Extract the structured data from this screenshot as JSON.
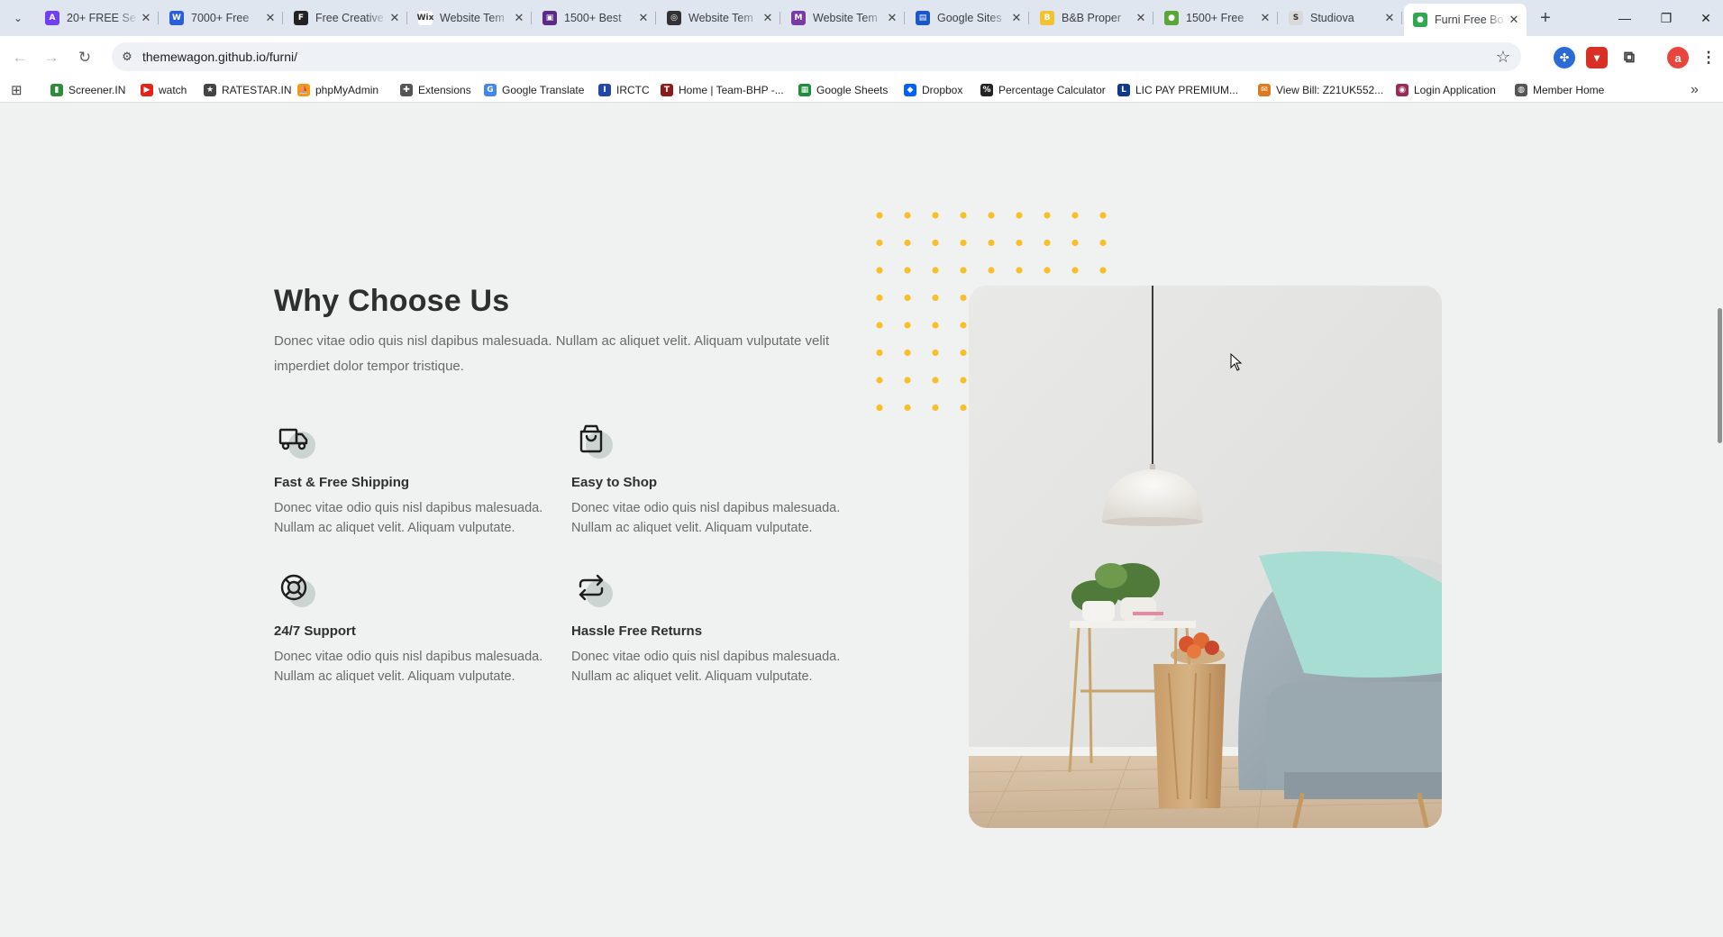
{
  "browser": {
    "tabs": [
      {
        "title": "20+ FREE Se",
        "color": "#6e3ff3",
        "glyph": "A"
      },
      {
        "title": "7000+ Free",
        "color": "#2b5fd9",
        "glyph": "W"
      },
      {
        "title": "Free Creative",
        "color": "#222222",
        "glyph": "F"
      },
      {
        "title": "Website Tem",
        "color": "#ffffff",
        "glyph": "Wix"
      },
      {
        "title": "1500+ Best",
        "color": "#5b2a86",
        "glyph": "▣"
      },
      {
        "title": "Website Tem",
        "color": "#333333",
        "glyph": "◎"
      },
      {
        "title": "Website Tem",
        "color": "#7a3aa6",
        "glyph": "M"
      },
      {
        "title": "Google Sites",
        "color": "#1a57c9",
        "glyph": "▤"
      },
      {
        "title": "B&B Proper",
        "color": "#f2c230",
        "glyph": "B"
      },
      {
        "title": "1500+ Free",
        "color": "#5aa637",
        "glyph": "●"
      },
      {
        "title": "Studiova",
        "color": "#d9d9d9",
        "glyph": "S"
      },
      {
        "title": "Furni Free Bo",
        "color": "#2fa84f",
        "glyph": "●",
        "active": true
      }
    ],
    "url": "themewagon.github.io/furni/",
    "profile_initial": "a",
    "bookmarks": [
      {
        "label": "Screener.IN",
        "color": "#2e8b3a",
        "glyph": "▮"
      },
      {
        "label": "watch",
        "color": "#e62117",
        "glyph": "▶"
      },
      {
        "label": "RATESTAR.IN",
        "color": "#444444",
        "glyph": "★"
      },
      {
        "label": "phpMyAdmin",
        "color": "#f29a18",
        "glyph": "⛵"
      },
      {
        "label": "Extensions",
        "color": "#555555",
        "glyph": "✚"
      },
      {
        "label": "Google Translate",
        "color": "#4285f4",
        "glyph": "G"
      },
      {
        "label": "IRCTC",
        "color": "#2446a6",
        "glyph": "I"
      },
      {
        "label": "Home | Team-BHP -...",
        "color": "#8c1b1b",
        "glyph": "T"
      },
      {
        "label": "Google Sheets",
        "color": "#1e8e3e",
        "glyph": "▦"
      },
      {
        "label": "Dropbox",
        "color": "#0061ff",
        "glyph": "◆"
      },
      {
        "label": "Percentage Calculator",
        "color": "#222222",
        "glyph": "%"
      },
      {
        "label": "LIC PAY PREMIUM...",
        "color": "#123a8c",
        "glyph": "L"
      },
      {
        "label": "View Bill: Z21UK552...",
        "color": "#e07a1f",
        "glyph": "✉"
      },
      {
        "label": "Login Application",
        "color": "#9b2c5a",
        "glyph": "◉"
      },
      {
        "label": "Member Home",
        "color": "#555555",
        "glyph": "◍"
      }
    ]
  },
  "section": {
    "title": "Why Choose Us",
    "intro": "Donec vitae odio quis nisl dapibus malesuada. Nullam ac aliquet velit. Aliquam vulputate velit imperdiet dolor tempor tristique.",
    "features": [
      {
        "icon": "truck-icon",
        "title": "Fast & Free Shipping",
        "text": "Donec vitae odio quis nisl dapibus malesuada. Nullam ac aliquet velit. Aliquam vulputate."
      },
      {
        "icon": "shopping-bag-icon",
        "title": "Easy to Shop",
        "text": "Donec vitae odio quis nisl dapibus malesuada. Nullam ac aliquet velit. Aliquam vulputate."
      },
      {
        "icon": "lifebuoy-icon",
        "title": "24/7 Support",
        "text": "Donec vitae odio quis nisl dapibus malesuada. Nullam ac aliquet velit. Aliquam vulputate."
      },
      {
        "icon": "return-arrows-icon",
        "title": "Hassle Free Returns",
        "text": "Donec vitae odio quis nisl dapibus malesuada. Nullam ac aliquet velit. Aliquam vulputate."
      }
    ]
  },
  "colors": {
    "page_bg": "#eff2f1",
    "heading": "#2f2f2f",
    "body_text": "#6a6a6a",
    "accent_dots": "#f9bf29",
    "icon_circle": "#3b5d50"
  }
}
